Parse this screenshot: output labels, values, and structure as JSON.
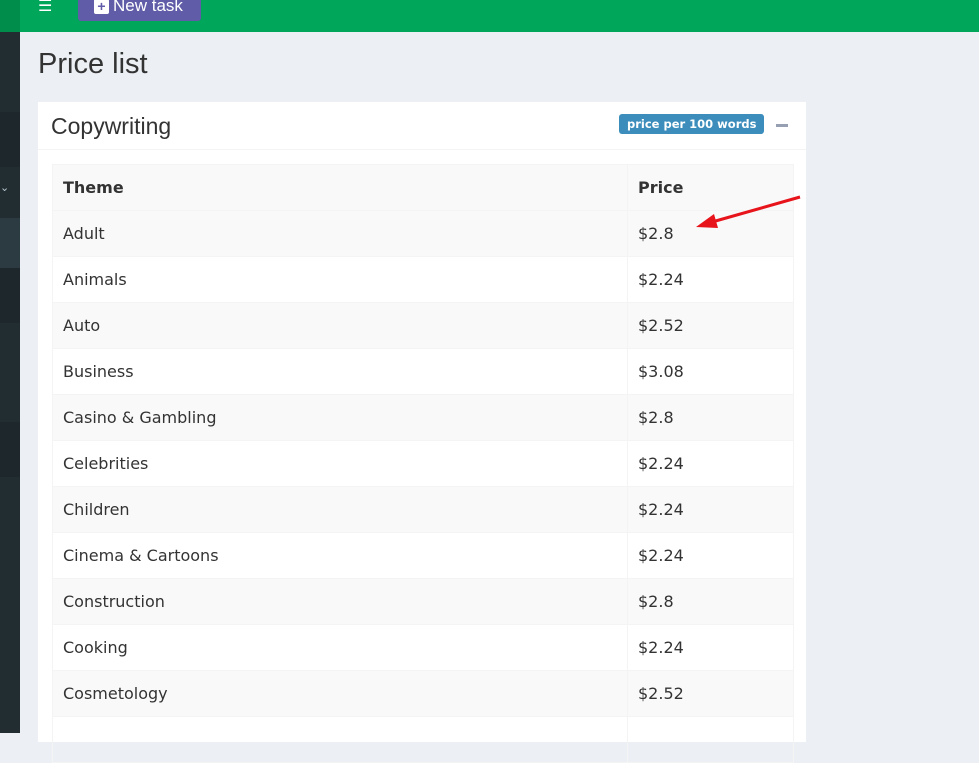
{
  "header": {
    "new_task_label": "New task",
    "menu_icon": "hamburger-icon"
  },
  "page_title": "Price list",
  "card": {
    "title": "Copywriting",
    "badge": "price per 100 words",
    "collapse_icon": "minus-icon"
  },
  "table": {
    "columns": [
      "Theme",
      "Price"
    ],
    "rows": [
      [
        "Adult",
        "$2.8"
      ],
      [
        "Animals",
        "$2.24"
      ],
      [
        "Auto",
        "$2.52"
      ],
      [
        "Business",
        "$3.08"
      ],
      [
        "Casino & Gambling",
        "$2.8"
      ],
      [
        "Celebrities",
        "$2.24"
      ],
      [
        "Children",
        "$2.24"
      ],
      [
        "Cinema & Cartoons",
        "$2.24"
      ],
      [
        "Construction",
        "$2.8"
      ],
      [
        "Cooking",
        "$2.24"
      ],
      [
        "Cosmetology",
        "$2.52"
      ]
    ]
  },
  "colors": {
    "topbar": "#00a65a",
    "new_task": "#605ca8",
    "badge": "#3c8dbc",
    "annotation": "#e8141b"
  }
}
